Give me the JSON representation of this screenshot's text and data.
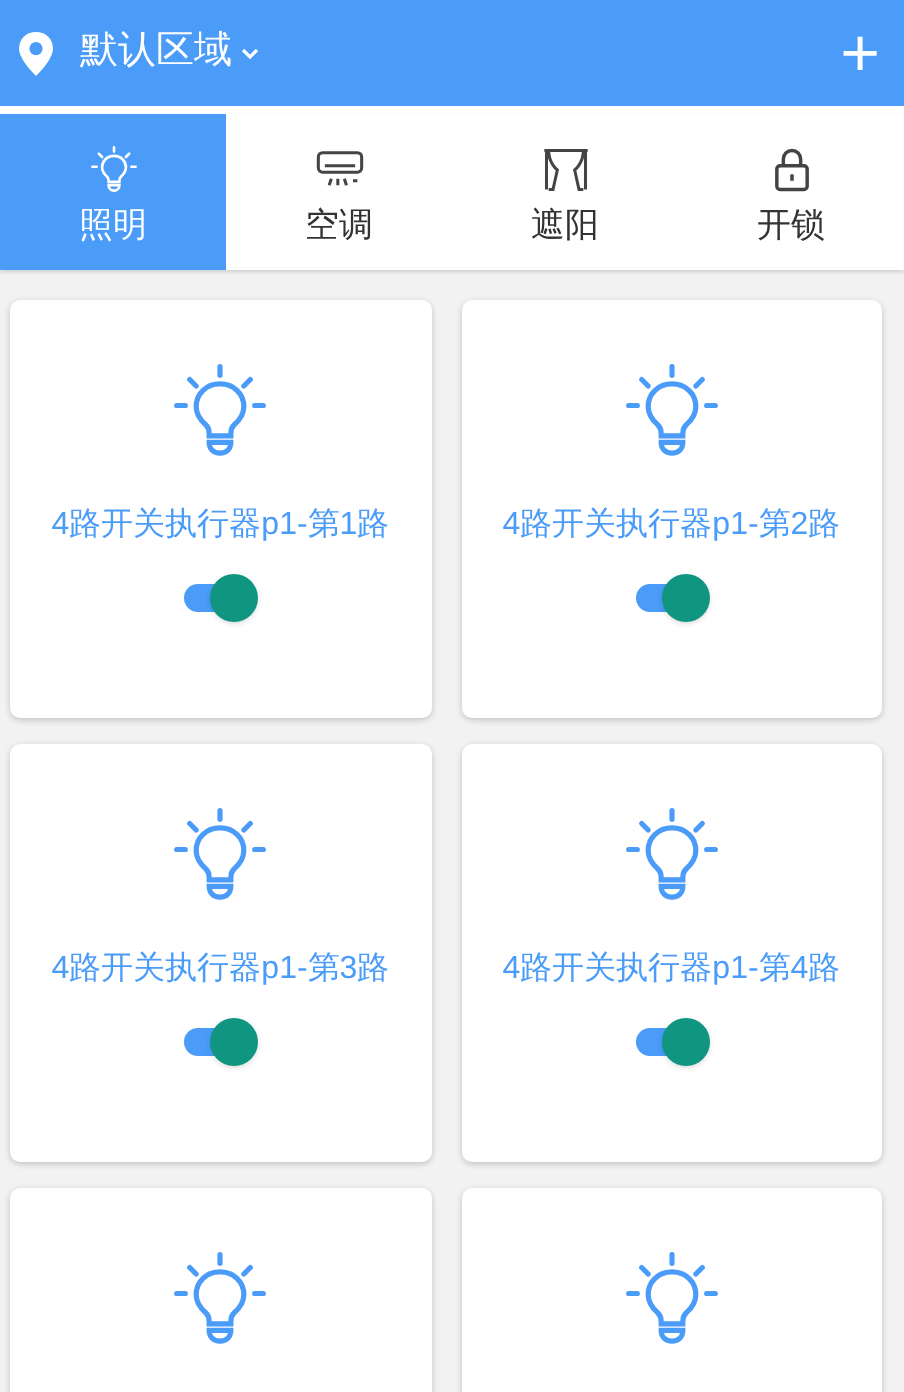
{
  "header": {
    "area": "默认区域",
    "add_button": "+"
  },
  "tabs": [
    {
      "label": "照明",
      "kind": "light",
      "selected": true
    },
    {
      "label": "空调",
      "kind": "aircon",
      "selected": false
    },
    {
      "label": "遮阳",
      "kind": "curtain",
      "selected": false
    },
    {
      "label": "开锁",
      "kind": "lock",
      "selected": false
    }
  ],
  "devices": [
    {
      "kind": "light",
      "name": "4路开关执行器p1-第1路",
      "on": true
    },
    {
      "kind": "light",
      "name": "4路开关执行器p1-第2路",
      "on": true
    },
    {
      "kind": "light",
      "name": "4路开关执行器p1-第3路",
      "on": true
    },
    {
      "kind": "light",
      "name": "4路开关执行器p1-第4路",
      "on": true
    },
    {
      "kind": "light"
    },
    {
      "kind": "light"
    }
  ]
}
